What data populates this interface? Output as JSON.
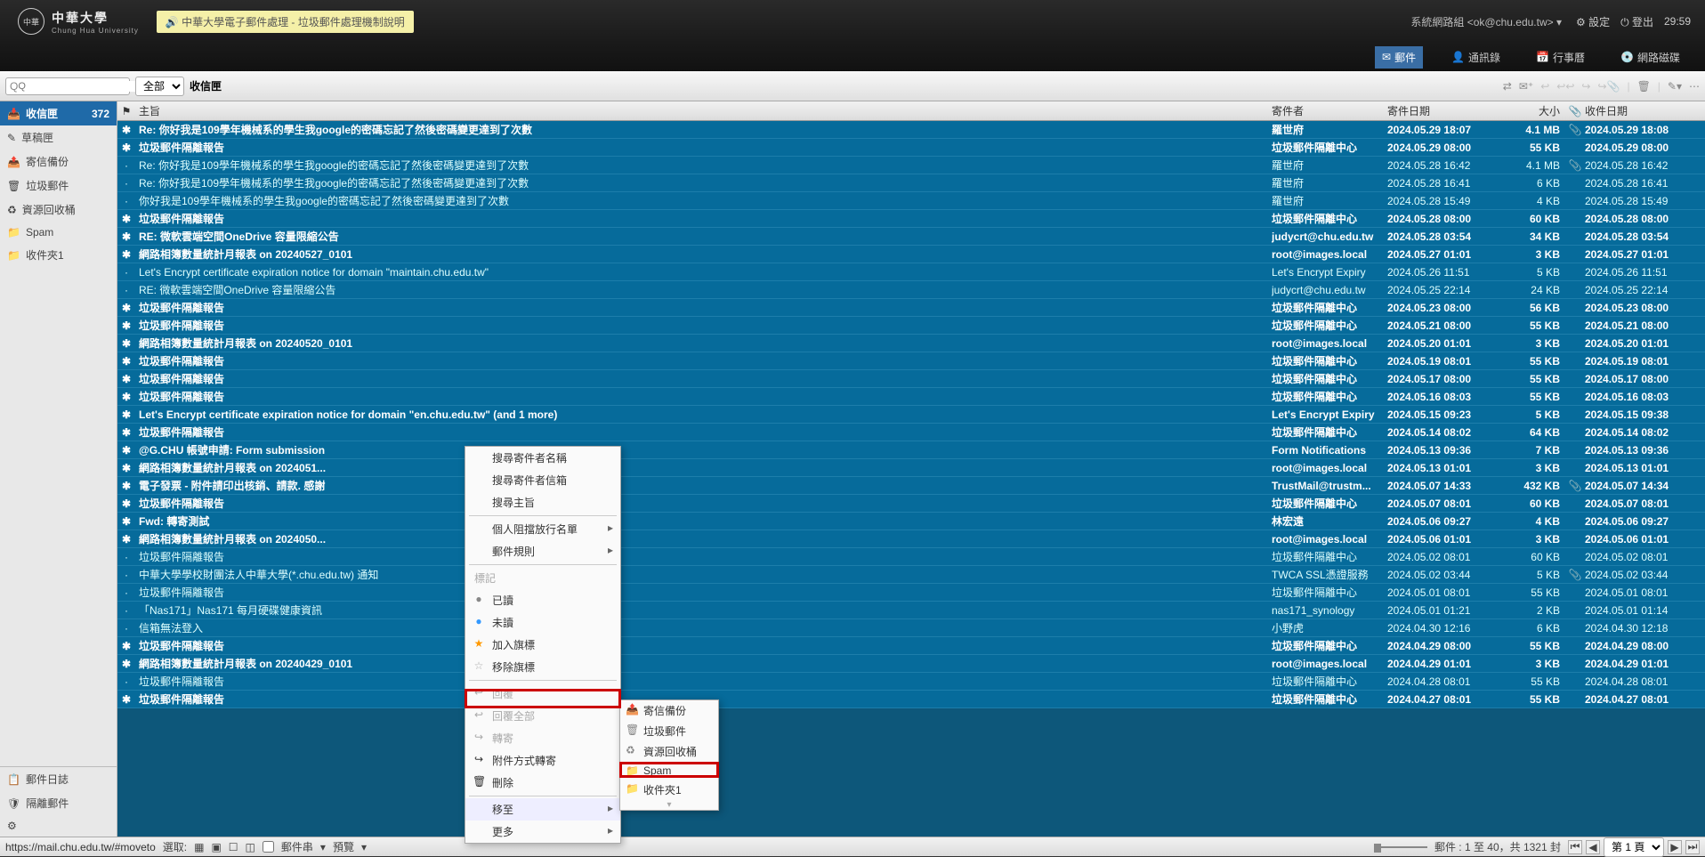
{
  "header": {
    "org": "中華大學",
    "org_en": "Chung Hua University",
    "notice": "中華大學電子郵件處理 - 垃圾郵件處理機制說明",
    "user": "系統網路組 <ok@chu.edu.tw>",
    "settings": "設定",
    "logout": "登出",
    "clock": "29:59"
  },
  "nav": {
    "mail": "郵件",
    "contacts": "通訊錄",
    "cal": "行事曆",
    "disk": "網路磁碟"
  },
  "toolbar": {
    "search_placeholder": "Q",
    "scope": "全部",
    "folder": "收信匣"
  },
  "sidebar": {
    "inbox": "收信匣",
    "inbox_cnt": "372",
    "drafts": "草稿匣",
    "sent": "寄信備份",
    "junk": "垃圾郵件",
    "trash": "資源回收桶",
    "spam": "Spam",
    "f1": "收件夾1",
    "maillog": "郵件日誌",
    "quarantine": "隔離郵件"
  },
  "cols": {
    "subject": "主旨",
    "from": "寄件者",
    "sentdate": "寄件日期",
    "size": "大小",
    "recvdate": "收件日期"
  },
  "mails": [
    {
      "u": 1,
      "s": "Re: 你好我是109學年機械系的學生我google的密碼忘記了然後密碼變更達到了次數",
      "f": "羅世府",
      "sd": "2024.05.29 18:07",
      "sz": "4.1 MB",
      "a": 1,
      "rd": "2024.05.29 18:08"
    },
    {
      "u": 1,
      "s": "垃圾郵件隔離報告",
      "f": "垃圾郵件隔離中心",
      "sd": "2024.05.29 08:00",
      "sz": "55 KB",
      "a": 0,
      "rd": "2024.05.29 08:00"
    },
    {
      "u": 0,
      "s": "Re: 你好我是109學年機械系的學生我google的密碼忘記了然後密碼變更達到了次數",
      "f": "羅世府",
      "sd": "2024.05.28 16:42",
      "sz": "4.1 MB",
      "a": 1,
      "rd": "2024.05.28 16:42"
    },
    {
      "u": 0,
      "s": "Re: 你好我是109學年機械系的學生我google的密碼忘記了然後密碼變更達到了次數",
      "f": "羅世府",
      "sd": "2024.05.28 16:41",
      "sz": "6 KB",
      "a": 0,
      "rd": "2024.05.28 16:41"
    },
    {
      "u": 0,
      "s": "你好我是109學年機械系的學生我google的密碼忘記了然後密碼變更達到了次數",
      "f": "羅世府",
      "sd": "2024.05.28 15:49",
      "sz": "4 KB",
      "a": 0,
      "rd": "2024.05.28 15:49"
    },
    {
      "u": 1,
      "s": "垃圾郵件隔離報告",
      "f": "垃圾郵件隔離中心",
      "sd": "2024.05.28 08:00",
      "sz": "60 KB",
      "a": 0,
      "rd": "2024.05.28 08:00"
    },
    {
      "u": 1,
      "s": "RE: 微軟雲端空間OneDrive 容量限縮公告",
      "f": "judycrt@chu.edu.tw",
      "sd": "2024.05.28 03:54",
      "sz": "34 KB",
      "a": 0,
      "rd": "2024.05.28 03:54"
    },
    {
      "u": 1,
      "s": "網路相簿數量統計月報表 on 20240527_0101",
      "f": "root@images.local",
      "sd": "2024.05.27 01:01",
      "sz": "3 KB",
      "a": 0,
      "rd": "2024.05.27 01:01"
    },
    {
      "u": 0,
      "s": "Let's Encrypt certificate expiration notice for domain \"maintain.chu.edu.tw\"",
      "f": "Let's Encrypt Expiry",
      "sd": "2024.05.26 11:51",
      "sz": "5 KB",
      "a": 0,
      "rd": "2024.05.26 11:51"
    },
    {
      "u": 0,
      "s": "RE: 微軟雲端空間OneDrive 容量限縮公告",
      "f": "judycrt@chu.edu.tw",
      "sd": "2024.05.25 22:14",
      "sz": "24 KB",
      "a": 0,
      "rd": "2024.05.25 22:14"
    },
    {
      "u": 1,
      "s": "垃圾郵件隔離報告",
      "f": "垃圾郵件隔離中心",
      "sd": "2024.05.23 08:00",
      "sz": "56 KB",
      "a": 0,
      "rd": "2024.05.23 08:00"
    },
    {
      "u": 1,
      "s": "垃圾郵件隔離報告",
      "f": "垃圾郵件隔離中心",
      "sd": "2024.05.21 08:00",
      "sz": "55 KB",
      "a": 0,
      "rd": "2024.05.21 08:00"
    },
    {
      "u": 1,
      "s": "網路相簿數量統計月報表 on 20240520_0101",
      "f": "root@images.local",
      "sd": "2024.05.20 01:01",
      "sz": "3 KB",
      "a": 0,
      "rd": "2024.05.20 01:01"
    },
    {
      "u": 1,
      "s": "垃圾郵件隔離報告",
      "f": "垃圾郵件隔離中心",
      "sd": "2024.05.19 08:01",
      "sz": "55 KB",
      "a": 0,
      "rd": "2024.05.19 08:01"
    },
    {
      "u": 1,
      "s": "垃圾郵件隔離報告",
      "f": "垃圾郵件隔離中心",
      "sd": "2024.05.17 08:00",
      "sz": "55 KB",
      "a": 0,
      "rd": "2024.05.17 08:00"
    },
    {
      "u": 1,
      "s": "垃圾郵件隔離報告",
      "f": "垃圾郵件隔離中心",
      "sd": "2024.05.16 08:03",
      "sz": "55 KB",
      "a": 0,
      "rd": "2024.05.16 08:03"
    },
    {
      "u": 1,
      "s": "Let's Encrypt certificate expiration notice for domain \"en.chu.edu.tw\" (and 1 more)",
      "f": "Let's Encrypt Expiry",
      "sd": "2024.05.15 09:23",
      "sz": "5 KB",
      "a": 0,
      "rd": "2024.05.15 09:38"
    },
    {
      "u": 1,
      "s": "垃圾郵件隔離報告",
      "f": "垃圾郵件隔離中心",
      "sd": "2024.05.14 08:02",
      "sz": "64 KB",
      "a": 0,
      "rd": "2024.05.14 08:02"
    },
    {
      "u": 1,
      "s": "@G.CHU 帳號申請: Form submission",
      "f": "Form Notifications",
      "sd": "2024.05.13 09:36",
      "sz": "7 KB",
      "a": 0,
      "rd": "2024.05.13 09:36"
    },
    {
      "u": 1,
      "s": "網路相簿數量統計月報表 on 2024051...",
      "f": "root@images.local",
      "sd": "2024.05.13 01:01",
      "sz": "3 KB",
      "a": 0,
      "rd": "2024.05.13 01:01"
    },
    {
      "u": 1,
      "s": "電子發票 - 附件請印出核銷、請款. 感謝",
      "f": "TrustMail@trustm...",
      "sd": "2024.05.07 14:33",
      "sz": "432 KB",
      "a": 1,
      "rd": "2024.05.07 14:34"
    },
    {
      "u": 1,
      "s": "垃圾郵件隔離報告",
      "f": "垃圾郵件隔離中心",
      "sd": "2024.05.07 08:01",
      "sz": "60 KB",
      "a": 0,
      "rd": "2024.05.07 08:01"
    },
    {
      "u": 1,
      "s": "Fwd: 轉寄測試",
      "f": "林宏遠",
      "sd": "2024.05.06 09:27",
      "sz": "4 KB",
      "a": 0,
      "rd": "2024.05.06 09:27"
    },
    {
      "u": 1,
      "s": "網路相簿數量統計月報表 on 2024050...",
      "f": "root@images.local",
      "sd": "2024.05.06 01:01",
      "sz": "3 KB",
      "a": 0,
      "rd": "2024.05.06 01:01"
    },
    {
      "u": 0,
      "s": "垃圾郵件隔離報告",
      "f": "垃圾郵件隔離中心",
      "sd": "2024.05.02 08:01",
      "sz": "60 KB",
      "a": 0,
      "rd": "2024.05.02 08:01"
    },
    {
      "u": 0,
      "s": "中華大學學校財團法人中華大學(*.chu.edu.tw) 通知",
      "f": "TWCA SSL憑證服務",
      "sd": "2024.05.02 03:44",
      "sz": "5 KB",
      "a": 1,
      "rd": "2024.05.02 03:44"
    },
    {
      "u": 0,
      "s": "垃圾郵件隔離報告",
      "f": "垃圾郵件隔離中心",
      "sd": "2024.05.01 08:01",
      "sz": "55 KB",
      "a": 0,
      "rd": "2024.05.01 08:01"
    },
    {
      "u": 0,
      "s": "「Nas171」Nas171 每月硬碟健康資訊",
      "f": "nas171_synology",
      "sd": "2024.05.01 01:21",
      "sz": "2 KB",
      "a": 0,
      "rd": "2024.05.01 01:14"
    },
    {
      "u": 0,
      "s": "信箱無法登入",
      "f": "小野虎",
      "sd": "2024.04.30 12:16",
      "sz": "6 KB",
      "a": 0,
      "rd": "2024.04.30 12:18"
    },
    {
      "u": 1,
      "s": "垃圾郵件隔離報告",
      "f": "垃圾郵件隔離中心",
      "sd": "2024.04.29 08:00",
      "sz": "55 KB",
      "a": 0,
      "rd": "2024.04.29 08:00"
    },
    {
      "u": 1,
      "s": "網路相簿數量統計月報表 on 20240429_0101",
      "f": "root@images.local",
      "sd": "2024.04.29 01:01",
      "sz": "3 KB",
      "a": 0,
      "rd": "2024.04.29 01:01"
    },
    {
      "u": 0,
      "s": "垃圾郵件隔離報告",
      "f": "垃圾郵件隔離中心",
      "sd": "2024.04.28 08:01",
      "sz": "55 KB",
      "a": 0,
      "rd": "2024.04.28 08:01"
    },
    {
      "u": 1,
      "s": "垃圾郵件隔離報告",
      "f": "垃圾郵件隔離中心",
      "sd": "2024.04.27 08:01",
      "sz": "55 KB",
      "a": 0,
      "rd": "2024.04.27 08:01"
    }
  ],
  "ctx": {
    "search_sender": "搜尋寄件者名稱",
    "search_senderbox": "搜尋寄件者信箱",
    "search_subj": "搜尋主旨",
    "blocklist": "個人阻擋放行名單",
    "rules": "郵件規則",
    "mark": "標記",
    "read": "已讀",
    "unread": "未讀",
    "flag": "加入旗標",
    "unflag": "移除旗標",
    "reply": "回覆",
    "replyall": "回覆全部",
    "fwd": "轉寄",
    "fwd_att": "附件方式轉寄",
    "del": "刪除",
    "moveto": "移至",
    "more": "更多"
  },
  "sub": {
    "sent": "寄信備份",
    "junk": "垃圾郵件",
    "trash": "資源回收桶",
    "spam": "Spam",
    "f1": "收件夾1"
  },
  "status": {
    "url": "https://mail.chu.edu.tw/#moveto",
    "select": "選取:",
    "thread": "郵件串",
    "preview": "預覽",
    "range": "郵件 : 1 至 40，共 1321 封",
    "page": "第 1 頁"
  }
}
